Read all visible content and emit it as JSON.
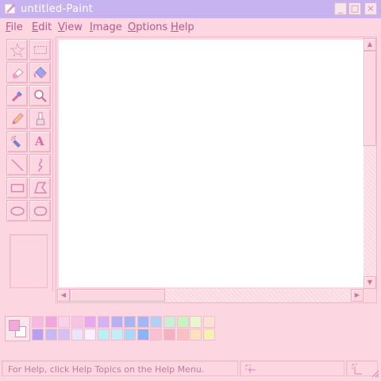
{
  "window": {
    "title": "untitled-Paint"
  },
  "titlebar": {
    "buttons": [
      {
        "name": "minimize",
        "glyph": "_"
      },
      {
        "name": "maximize",
        "glyph": "□"
      },
      {
        "name": "close",
        "glyph": "×"
      }
    ]
  },
  "menu": [
    "File",
    "Edit",
    "View",
    "Image",
    "Options",
    "Help"
  ],
  "tools": [
    {
      "name": "free-form-select",
      "icon": "star-select-icon"
    },
    {
      "name": "rect-select",
      "icon": "rect-select-icon"
    },
    {
      "name": "eraser",
      "icon": "eraser-icon"
    },
    {
      "name": "fill",
      "icon": "paint-bucket-icon"
    },
    {
      "name": "color-picker",
      "icon": "eyedropper-icon"
    },
    {
      "name": "magnifier",
      "icon": "magnifier-icon"
    },
    {
      "name": "pencil",
      "icon": "pencil-icon"
    },
    {
      "name": "brush",
      "icon": "brush-icon"
    },
    {
      "name": "airbrush",
      "icon": "airbrush-icon"
    },
    {
      "name": "text",
      "icon": "text-icon",
      "glyph": "A"
    },
    {
      "name": "line",
      "icon": "line-icon"
    },
    {
      "name": "curve",
      "icon": "curve-icon"
    },
    {
      "name": "rectangle",
      "icon": "rectangle-icon"
    },
    {
      "name": "polygon",
      "icon": "polygon-icon"
    },
    {
      "name": "ellipse",
      "icon": "ellipse-icon"
    },
    {
      "name": "rounded-rect",
      "icon": "rounded-rect-icon"
    }
  ],
  "colors": {
    "foreground": "#f4a8d8",
    "background": "#ffffff",
    "palette_top": [
      "#f8b8e0",
      "#f3a6dc",
      "#fbd0e8",
      "#f6c4e6",
      "#e8a8f0",
      "#d8b0f4",
      "#b7b0f8",
      "#a8b4f6",
      "#a0b8f8",
      "#b0d0f4",
      "#c6f0d4",
      "#c8f4c0",
      "#eaf6d0",
      "#fbe0d4"
    ],
    "palette_bottom": [
      "#b7a0f0",
      "#c8b8f4",
      "#d4c0f4",
      "#ece4fa",
      "#f8f0fb",
      "#b8f0f4",
      "#bff0f8",
      "#a8d8f8",
      "#8cb4f4",
      "#f8c0d0",
      "#f6b0c4",
      "#f8c0c0",
      "#fce0c0",
      "#f8f0b0"
    ]
  },
  "status": {
    "help_text": "For Help, click Help Topics on the Help Menu."
  }
}
